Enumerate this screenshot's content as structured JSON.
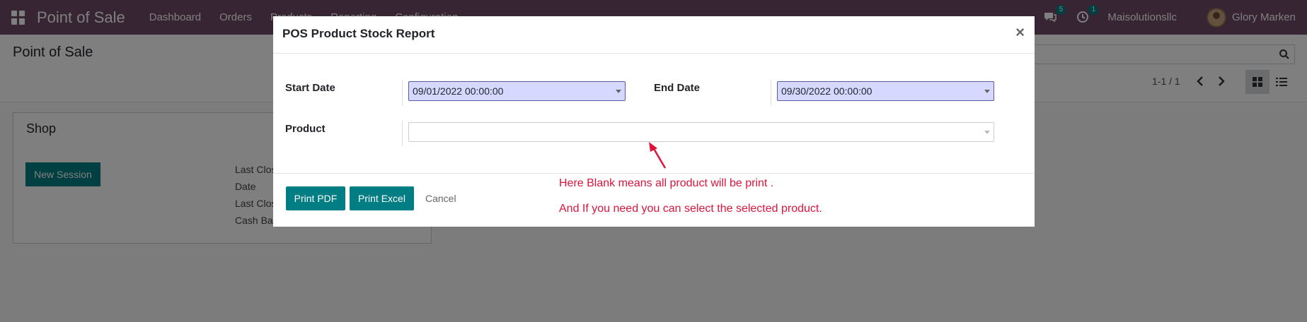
{
  "navbar": {
    "brand": "Point of Sale",
    "menu": [
      "Dashboard",
      "Orders",
      "Products",
      "Reporting",
      "Configuration"
    ],
    "messages_badge": "5",
    "activities_badge": "1",
    "company": "Maisolutionsllc",
    "user": "Glory Marken"
  },
  "control_panel": {
    "title": "Point of Sale",
    "pager": "1-1 / 1"
  },
  "card": {
    "title": "Shop",
    "new_session": "New Session",
    "labels": [
      "Last Clos",
      "Date",
      "Last Clos",
      "Cash Ba"
    ]
  },
  "modal": {
    "title": "POS Product Stock Report",
    "close": "×",
    "start_date_label": "Start Date",
    "start_date_value": "09/01/2022 00:00:00",
    "end_date_label": "End Date",
    "end_date_value": "09/30/2022 00:00:00",
    "product_label": "Product",
    "product_value": "",
    "print_pdf": "Print PDF",
    "print_excel": "Print Excel",
    "cancel": "Cancel"
  },
  "annotations": {
    "line1": "Here Blank means all product will be print .",
    "line2": "And If you need you can select the selected product.",
    "color": "#dc143c"
  },
  "colors": {
    "navbar": "#714b67",
    "primary": "#017e84",
    "date_field": "#d6d8ff"
  }
}
